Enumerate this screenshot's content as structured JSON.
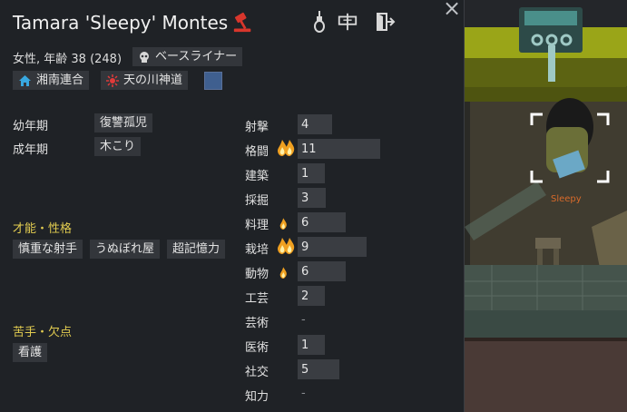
{
  "header": {
    "name": "Tamara 'Sleepy' Montes",
    "close": "×",
    "icons": [
      "gavel-icon",
      "noose-icon",
      "sign-icon",
      "exit-door-icon"
    ]
  },
  "info": {
    "subline": "女性, 年齢 38 (248)",
    "xenotype": "ベースライナー",
    "faction": "湘南連合",
    "ideology": "天の川神道",
    "color_swatch": "#3f5f8f"
  },
  "backstory": {
    "childhood_label": "幼年期",
    "childhood_value": "復讐孤児",
    "adulthood_label": "成年期",
    "adulthood_value": "木こり"
  },
  "traits": {
    "heading": "才能・性格",
    "items": [
      "慎重な射手",
      "うぬぼれ屋",
      "超記憶力"
    ]
  },
  "incapable": {
    "heading": "苦手・欠点",
    "items": [
      "看護"
    ]
  },
  "skills": [
    {
      "name": "射撃",
      "value": "4",
      "level": 4,
      "passion": 0
    },
    {
      "name": "格闘",
      "value": "11",
      "level": 11,
      "passion": 2
    },
    {
      "name": "建築",
      "value": "1",
      "level": 1,
      "passion": 0
    },
    {
      "name": "採掘",
      "value": "3",
      "level": 3,
      "passion": 0
    },
    {
      "name": "料理",
      "value": "6",
      "level": 6,
      "passion": 1
    },
    {
      "name": "栽培",
      "value": "9",
      "level": 9,
      "passion": 2
    },
    {
      "name": "動物",
      "value": "6",
      "level": 6,
      "passion": 1
    },
    {
      "name": "工芸",
      "value": "2",
      "level": 2,
      "passion": 0
    },
    {
      "name": "芸術",
      "value": "-",
      "level": 0,
      "passion": 0
    },
    {
      "name": "医術",
      "value": "1",
      "level": 1,
      "passion": 0
    },
    {
      "name": "社交",
      "value": "5",
      "level": 5,
      "passion": 0
    },
    {
      "name": "知力",
      "value": "-",
      "level": 0,
      "passion": 0
    }
  ],
  "world": {
    "pawn_label": "Sleepy"
  },
  "colors": {
    "section_heading": "#e2cc50",
    "flame": "#f0a020",
    "panel_bg": "#1f2226",
    "chip_bg": "#33363b"
  }
}
